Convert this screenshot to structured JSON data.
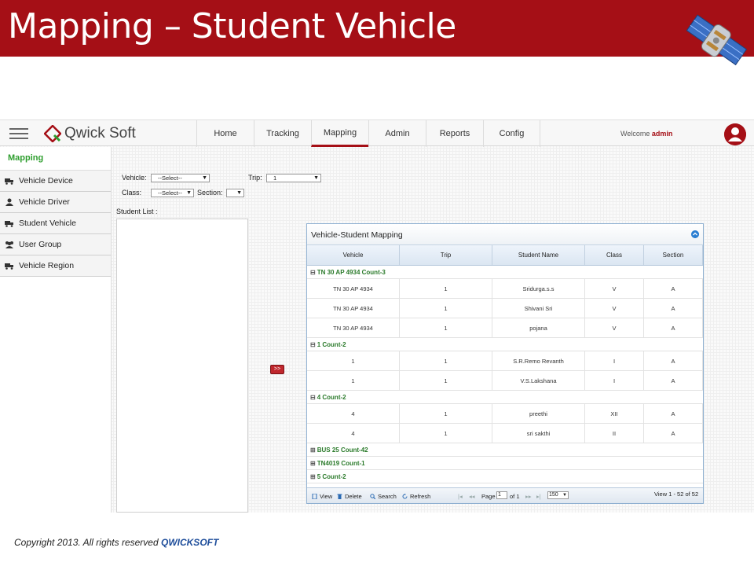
{
  "slide": {
    "title": "Mapping – Student Vehicle",
    "copyright_prefix": "Copyright 2013. All rights reserved ",
    "copyright_brand": "QWICKSOFT"
  },
  "app": {
    "logo_text": "Qwick Soft",
    "nav": [
      "Home",
      "Tracking",
      "Mapping",
      "Admin",
      "Reports",
      "Config"
    ],
    "active_nav": "Mapping",
    "welcome_prefix": "Welcome ",
    "welcome_user": "admin",
    "accent_color": "#a50f16"
  },
  "sidebar": {
    "heading": "Mapping",
    "items": [
      {
        "label": "Vehicle Device",
        "icon": "truck-icon"
      },
      {
        "label": "Vehicle Driver",
        "icon": "person-icon"
      },
      {
        "label": "Student Vehicle",
        "icon": "truck-icon"
      },
      {
        "label": "User Group",
        "icon": "users-icon"
      },
      {
        "label": "Vehicle Region",
        "icon": "truck-icon"
      }
    ]
  },
  "filters": {
    "vehicle_label": "Vehicle:",
    "vehicle_value": "--Select--",
    "trip_label": "Trip:",
    "trip_value": "1",
    "class_label": "Class:",
    "class_value": "--Select--",
    "section_label": "Section:",
    "section_value": ""
  },
  "student_list_label": "Student List :",
  "move_button": ">>",
  "grid": {
    "title": "Vehicle-Student Mapping",
    "columns": [
      "Vehicle",
      "Trip",
      "Student Name",
      "Class",
      "Section"
    ],
    "groups": [
      {
        "label": "TN 30 AP 4934  Count-3",
        "toggle": "⊟",
        "rows": [
          [
            "TN 30 AP 4934",
            "1",
            "Sridurga.s.s",
            "V",
            "A"
          ],
          [
            "TN 30 AP 4934",
            "1",
            "Shivani Sri",
            "V",
            "A"
          ],
          [
            "TN 30 AP 4934",
            "1",
            "pojana",
            "V",
            "A"
          ]
        ]
      },
      {
        "label": "1  Count-2",
        "toggle": "⊟",
        "rows": [
          [
            "1",
            "1",
            "S.R.Remo Revanth",
            "I",
            "A"
          ],
          [
            "1",
            "1",
            "V.S.Lakshana",
            "I",
            "A"
          ]
        ]
      },
      {
        "label": "4  Count-2",
        "toggle": "⊟",
        "rows": [
          [
            "4",
            "1",
            "preethi",
            "XII",
            "A"
          ],
          [
            "4",
            "1",
            "sri sakthi",
            "II",
            "A"
          ]
        ]
      },
      {
        "label": "BUS 25  Count-42",
        "toggle": "⊞",
        "rows": []
      },
      {
        "label": "TN4019  Count-1",
        "toggle": "⊞",
        "rows": []
      },
      {
        "label": "5  Count-2",
        "toggle": "⊞",
        "rows": []
      }
    ],
    "pager": {
      "view": "View",
      "delete": "Delete",
      "search": "Search",
      "refresh": "Refresh",
      "page_label": "Page",
      "page_value": "1",
      "of_label": "of 1",
      "page_size": "150",
      "records": "View 1 - 52 of 52"
    }
  }
}
